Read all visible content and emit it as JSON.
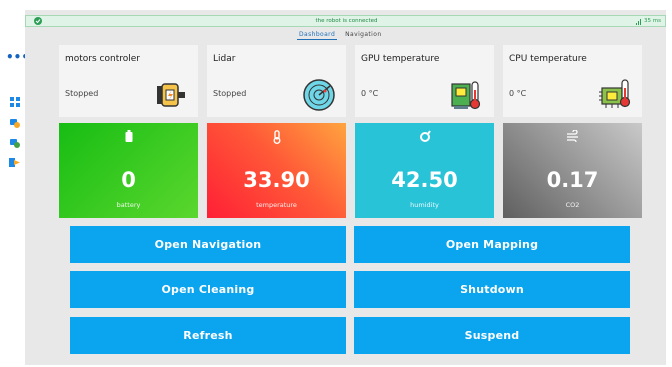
{
  "status": {
    "message": "the robot is connected",
    "latency": "35 ms",
    "color": "#2e9d56"
  },
  "tabs": [
    {
      "label": "Dashboard",
      "active": true
    },
    {
      "label": "Navigation",
      "active": false
    }
  ],
  "rail": {
    "menu_icon": "more-horizontal-icon",
    "menu_glyph": "•••",
    "icons": [
      "dashboard-icon",
      "robot-settings-icon",
      "robot-add-icon",
      "logout-icon"
    ]
  },
  "info_cards": [
    {
      "title": "motors controler",
      "value": "Stopped",
      "icon": "motor-icon"
    },
    {
      "title": "Lidar",
      "value": "Stopped",
      "icon": "radar-icon"
    },
    {
      "title": "GPU temperature",
      "value": "0 °C",
      "icon": "gpu-thermometer-icon"
    },
    {
      "title": "CPU temperature",
      "value": "0 °C",
      "icon": "cpu-thermometer-icon"
    }
  ],
  "sensors": [
    {
      "value": "0",
      "label": "battery",
      "icon": "battery-icon",
      "colors": [
        "#1fc01a",
        "#56d42b"
      ]
    },
    {
      "value": "33.90",
      "label": "temperature",
      "icon": "thermometer-icon",
      "colors": [
        "#ff2f3a",
        "#ff9a3c"
      ]
    },
    {
      "value": "42.50",
      "label": "humidity",
      "icon": "droplet-icon",
      "colors": [
        "#27c2d6",
        "#2ec7da"
      ]
    },
    {
      "value": "0.17",
      "label": "CO2",
      "icon": "wind-icon",
      "colors": [
        "#6a6a6a",
        "#bdbdbd"
      ]
    }
  ],
  "actions": [
    {
      "label": "Open Navigation"
    },
    {
      "label": "Open Mapping"
    },
    {
      "label": "Open Cleaning"
    },
    {
      "label": "Shutdown"
    },
    {
      "label": "Refresh"
    },
    {
      "label": "Suspend"
    }
  ],
  "accent": "#0aa4ef"
}
